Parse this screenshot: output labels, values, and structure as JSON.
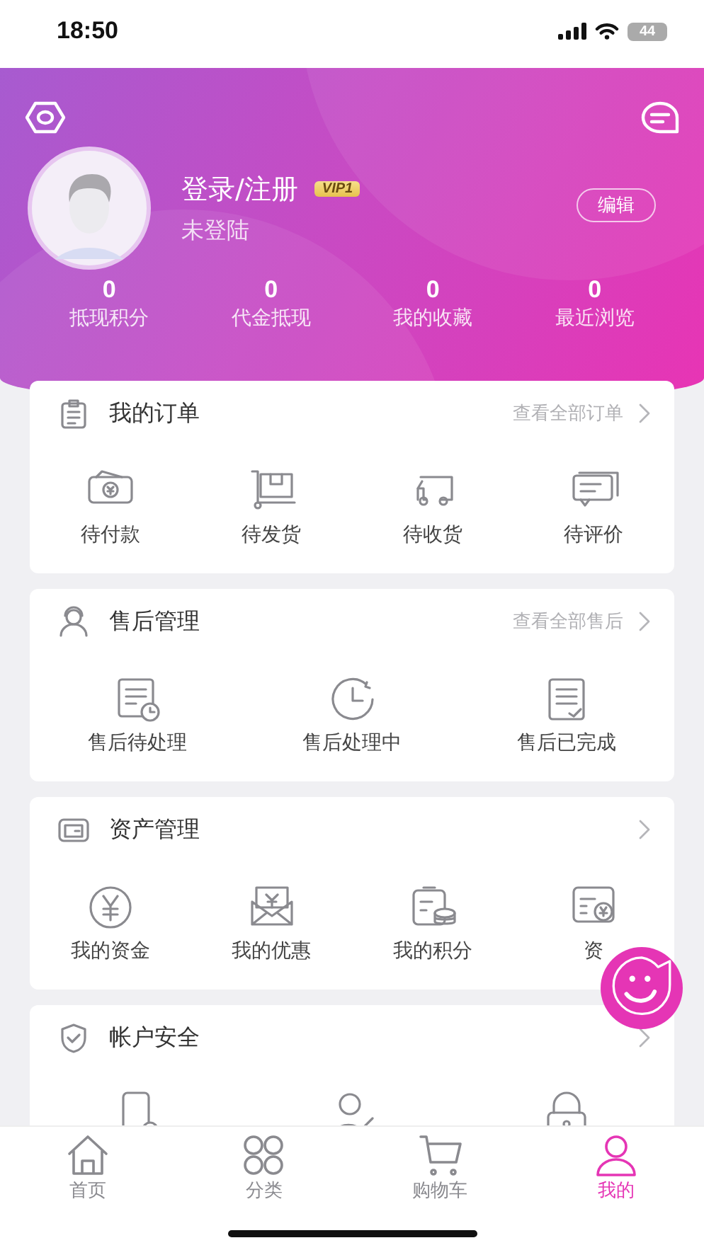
{
  "status_bar": {
    "time": "18:50",
    "battery": "44"
  },
  "header": {
    "name": "登录/注册",
    "vip": "VIP1",
    "status": "未登陆",
    "edit_button": "编辑",
    "stats": [
      {
        "value": "0",
        "label": "抵现积分"
      },
      {
        "value": "0",
        "label": "代金抵现"
      },
      {
        "value": "0",
        "label": "我的收藏"
      },
      {
        "value": "0",
        "label": "最近浏览"
      }
    ]
  },
  "sections": [
    {
      "title": "我的订单",
      "link": "查看全部订单",
      "items": [
        {
          "label": "待付款"
        },
        {
          "label": "待发货"
        },
        {
          "label": "待收货"
        },
        {
          "label": "待评价"
        }
      ]
    },
    {
      "title": "售后管理",
      "link": "查看全部售后",
      "items": [
        {
          "label": "售后待处理"
        },
        {
          "label": "售后处理中"
        },
        {
          "label": "售后已完成"
        }
      ]
    },
    {
      "title": "资产管理",
      "items": [
        {
          "label": "我的资金"
        },
        {
          "label": "我的优惠"
        },
        {
          "label": "我的积分"
        },
        {
          "label": "资"
        }
      ]
    },
    {
      "title": "帐户安全"
    }
  ],
  "tabs": [
    {
      "label": "首页",
      "selected": false
    },
    {
      "label": "分类",
      "selected": false
    },
    {
      "label": "购物车",
      "selected": false
    },
    {
      "label": "我的",
      "selected": true
    }
  ]
}
